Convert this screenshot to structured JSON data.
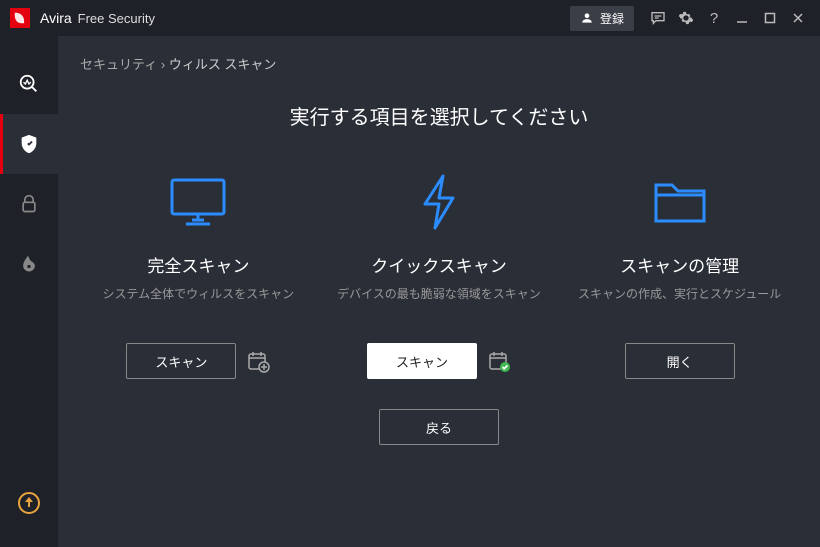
{
  "titlebar": {
    "app_name": "Avira",
    "app_sub": "Free Security",
    "login_label": "登録"
  },
  "breadcrumb": {
    "root": "セキュリティ",
    "current": "ウィルス スキャン"
  },
  "page_title": "実行する項目を選択してください",
  "cards": {
    "full": {
      "title": "完全スキャン",
      "desc": "システム全体でウィルスをスキャン",
      "button": "スキャン"
    },
    "quick": {
      "title": "クイックスキャン",
      "desc": "デバイスの最も脆弱な領域をスキャン",
      "button": "スキャン"
    },
    "manage": {
      "title": "スキャンの管理",
      "desc": "スキャンの作成、実行とスケジュール",
      "button": "開く"
    }
  },
  "back_label": "戻る",
  "colors": {
    "accent": "#2a8cff"
  }
}
